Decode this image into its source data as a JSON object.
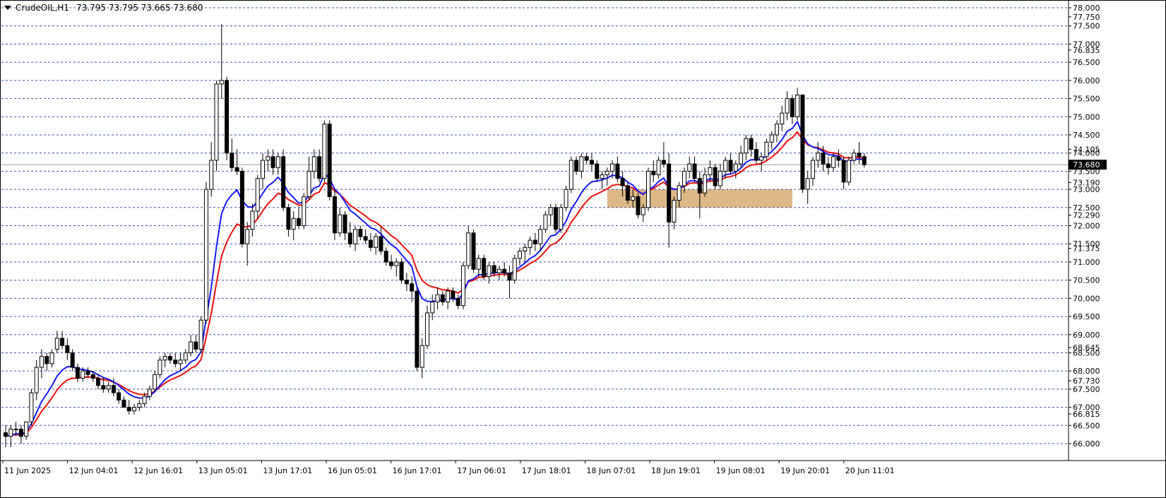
{
  "header": {
    "symbol_timeframe": "CrudeOIL,H1",
    "ohlc": "73.795 73.795 73.665 73.680"
  },
  "colors": {
    "background": "#ffffff",
    "grid": "#1c3a9a",
    "bull_fill": "#ffffff",
    "bear_fill": "#000000",
    "candle_outline": "#000000",
    "ma_fast": "#1a1aff",
    "ma_slow": "#ee1111",
    "zone": "#deb887",
    "current_price_badge": "#000000",
    "current_price_line": "#9a9a9a"
  },
  "chart_data": {
    "type": "candlestick",
    "symbol": "CrudeOIL",
    "timeframe": "H1",
    "y_range": [
      65.8,
      78.0
    ],
    "grid": true,
    "price_levels": [
      78.0,
      77.5,
      77.0,
      76.5,
      76.0,
      75.5,
      75.0,
      74.5,
      74.0,
      73.5,
      73.0,
      72.5,
      72.0,
      71.5,
      71.0,
      70.5,
      70.0,
      69.5,
      69.0,
      68.5,
      68.0,
      67.5,
      67.0,
      66.5,
      66.0
    ],
    "y_tick_labels": [
      "78.000",
      "77.750",
      "77.500",
      "77.000",
      "76.835",
      "76.500",
      "76.000",
      "75.500",
      "75.000",
      "74.500",
      "74.105",
      "74.000",
      "73.500",
      "73.190",
      "73.000",
      "72.500",
      "72.290",
      "72.000",
      "71.500",
      "71.375",
      "71.000",
      "70.500",
      "70.000",
      "69.500",
      "69.000",
      "68.645",
      "68.500",
      "68.000",
      "67.730",
      "67.500",
      "67.000",
      "66.815",
      "66.500",
      "66.000"
    ],
    "x_labels": [
      "11 Jun 2025",
      "12 Jun 04:01",
      "12 Jun 16:01",
      "13 Jun 05:01",
      "13 Jun 17:01",
      "16 Jun 05:01",
      "16 Jun 17:01",
      "17 Jun 06:01",
      "17 Jun 18:01",
      "18 Jun 07:01",
      "18 Jun 19:01",
      "19 Jun 08:01",
      "19 Jun 20:01",
      "20 Jun 11:01"
    ],
    "current_price": 73.68,
    "current_price_label": "73.680",
    "zone": {
      "price_top": 73.0,
      "price_bottom": 72.5,
      "start_bar": 117,
      "end_bar": 153
    },
    "candles": [
      [
        66.3,
        66.5,
        65.9,
        66.2
      ],
      [
        66.2,
        66.5,
        65.9,
        66.4
      ],
      [
        66.4,
        66.6,
        66.2,
        66.4
      ],
      [
        66.4,
        66.5,
        66.0,
        66.2
      ],
      [
        66.2,
        66.6,
        66.1,
        66.6
      ],
      [
        66.6,
        67.5,
        66.5,
        67.4
      ],
      [
        67.4,
        68.3,
        67.2,
        68.1
      ],
      [
        68.1,
        68.6,
        67.8,
        68.4
      ],
      [
        68.4,
        68.5,
        68.0,
        68.2
      ],
      [
        68.2,
        68.6,
        68.1,
        68.5
      ],
      [
        68.6,
        69.1,
        68.5,
        68.9
      ],
      [
        68.9,
        69.1,
        68.6,
        68.7
      ],
      [
        68.7,
        68.9,
        68.3,
        68.5
      ],
      [
        68.5,
        68.6,
        68.0,
        68.1
      ],
      [
        68.1,
        68.2,
        67.7,
        67.8
      ],
      [
        67.8,
        68.1,
        67.7,
        68.0
      ],
      [
        68.0,
        68.1,
        67.8,
        67.9
      ],
      [
        67.9,
        68.0,
        67.7,
        67.8
      ],
      [
        67.8,
        67.9,
        67.5,
        67.6
      ],
      [
        67.6,
        67.8,
        67.4,
        67.5
      ],
      [
        67.5,
        67.7,
        67.4,
        67.6
      ],
      [
        67.6,
        67.8,
        67.3,
        67.4
      ],
      [
        67.4,
        67.5,
        67.1,
        67.2
      ],
      [
        67.2,
        67.3,
        67.0,
        67.0
      ],
      [
        67.0,
        67.2,
        66.8,
        66.9
      ],
      [
        66.9,
        67.1,
        66.8,
        67.0
      ],
      [
        67.0,
        67.2,
        66.9,
        67.1
      ],
      [
        67.1,
        67.4,
        67.0,
        67.3
      ],
      [
        67.3,
        67.6,
        67.2,
        67.5
      ],
      [
        67.5,
        68.0,
        67.4,
        67.9
      ],
      [
        67.9,
        68.4,
        67.8,
        68.3
      ],
      [
        68.3,
        68.5,
        68.1,
        68.4
      ],
      [
        68.4,
        68.5,
        68.2,
        68.3
      ],
      [
        68.3,
        68.5,
        68.1,
        68.2
      ],
      [
        68.2,
        68.5,
        68.0,
        68.3
      ],
      [
        68.3,
        68.6,
        68.2,
        68.5
      ],
      [
        68.5,
        69.0,
        68.4,
        68.8
      ],
      [
        68.8,
        69.0,
        68.5,
        68.6
      ],
      [
        68.6,
        69.5,
        68.5,
        69.4
      ],
      [
        69.4,
        73.2,
        69.3,
        73.0
      ],
      [
        73.0,
        74.3,
        72.8,
        73.8
      ],
      [
        73.8,
        76.0,
        73.5,
        75.9
      ],
      [
        75.9,
        77.55,
        75.5,
        76.0
      ],
      [
        76.0,
        76.1,
        73.8,
        74.0
      ],
      [
        74.0,
        74.4,
        73.5,
        73.6
      ],
      [
        73.6,
        74.1,
        73.4,
        73.5
      ],
      [
        73.5,
        73.6,
        71.4,
        71.5
      ],
      [
        71.5,
        72.1,
        70.9,
        71.9
      ],
      [
        71.9,
        72.6,
        71.7,
        72.4
      ],
      [
        72.4,
        73.4,
        72.2,
        73.3
      ],
      [
        73.3,
        74.0,
        73.0,
        73.8
      ],
      [
        73.8,
        74.1,
        73.5,
        73.9
      ],
      [
        73.9,
        74.1,
        73.4,
        73.6
      ],
      [
        73.6,
        74.0,
        73.4,
        73.9
      ],
      [
        73.9,
        74.1,
        72.4,
        72.5
      ],
      [
        72.5,
        72.6,
        71.7,
        71.9
      ],
      [
        71.9,
        72.4,
        71.6,
        72.2
      ],
      [
        72.2,
        72.5,
        71.9,
        72.0
      ],
      [
        72.0,
        72.9,
        71.9,
        72.8
      ],
      [
        72.8,
        73.9,
        72.7,
        73.5
      ],
      [
        73.5,
        74.1,
        73.3,
        73.9
      ],
      [
        73.9,
        74.1,
        73.2,
        73.3
      ],
      [
        73.3,
        74.9,
        73.2,
        74.8
      ],
      [
        74.8,
        74.9,
        72.7,
        72.8
      ],
      [
        72.8,
        73.0,
        71.6,
        71.8
      ],
      [
        71.8,
        72.5,
        71.7,
        72.3
      ],
      [
        72.3,
        72.4,
        71.6,
        71.8
      ],
      [
        71.8,
        72.1,
        71.4,
        71.5
      ],
      [
        71.5,
        72.0,
        71.3,
        71.9
      ],
      [
        71.9,
        72.0,
        71.6,
        71.7
      ],
      [
        71.7,
        71.9,
        71.5,
        71.6
      ],
      [
        71.6,
        71.8,
        71.3,
        71.4
      ],
      [
        71.4,
        71.8,
        71.2,
        71.7
      ],
      [
        71.7,
        72.0,
        71.2,
        71.3
      ],
      [
        71.3,
        71.4,
        70.9,
        71.0
      ],
      [
        71.0,
        71.2,
        70.8,
        70.9
      ],
      [
        70.9,
        71.1,
        70.6,
        71.0
      ],
      [
        71.0,
        71.1,
        70.4,
        70.5
      ],
      [
        70.5,
        70.7,
        70.2,
        70.4
      ],
      [
        70.4,
        70.6,
        69.9,
        70.2
      ],
      [
        70.2,
        70.3,
        68.0,
        68.1
      ],
      [
        68.1,
        68.9,
        67.8,
        68.7
      ],
      [
        68.7,
        69.8,
        68.6,
        69.6
      ],
      [
        69.6,
        70.1,
        69.4,
        69.9
      ],
      [
        69.9,
        70.3,
        69.7,
        70.1
      ],
      [
        70.1,
        70.2,
        69.8,
        69.9
      ],
      [
        69.9,
        70.3,
        69.7,
        70.2
      ],
      [
        70.2,
        70.3,
        69.9,
        70.0
      ],
      [
        70.0,
        70.1,
        69.7,
        69.8
      ],
      [
        69.8,
        71.0,
        69.7,
        70.9
      ],
      [
        70.9,
        72.0,
        70.8,
        71.8
      ],
      [
        71.8,
        71.9,
        70.7,
        70.8
      ],
      [
        70.8,
        71.2,
        70.6,
        71.1
      ],
      [
        71.1,
        71.2,
        70.5,
        70.6
      ],
      [
        70.6,
        71.0,
        70.4,
        70.9
      ],
      [
        70.9,
        71.0,
        70.6,
        70.7
      ],
      [
        70.7,
        70.9,
        70.5,
        70.8
      ],
      [
        70.8,
        71.0,
        70.6,
        70.7
      ],
      [
        70.7,
        70.9,
        70.0,
        70.5
      ],
      [
        70.5,
        71.2,
        70.4,
        71.1
      ],
      [
        71.1,
        71.4,
        70.9,
        71.3
      ],
      [
        71.3,
        71.5,
        71.0,
        71.4
      ],
      [
        71.4,
        71.7,
        71.2,
        71.6
      ],
      [
        71.6,
        71.8,
        71.3,
        71.5
      ],
      [
        71.5,
        72.0,
        71.3,
        71.9
      ],
      [
        71.9,
        72.4,
        71.8,
        72.3
      ],
      [
        72.3,
        72.6,
        72.0,
        72.5
      ],
      [
        72.5,
        72.6,
        71.8,
        71.9
      ],
      [
        71.9,
        72.6,
        71.8,
        72.5
      ],
      [
        72.5,
        73.1,
        72.4,
        73.0
      ],
      [
        73.0,
        73.9,
        72.9,
        73.8
      ],
      [
        73.8,
        73.9,
        73.4,
        73.5
      ],
      [
        73.5,
        74.0,
        73.3,
        73.9
      ],
      [
        73.9,
        74.0,
        73.7,
        73.8
      ],
      [
        73.8,
        74.0,
        73.5,
        73.7
      ],
      [
        73.7,
        73.8,
        73.2,
        73.3
      ],
      [
        73.3,
        73.5,
        73.0,
        73.4
      ],
      [
        73.4,
        73.6,
        73.1,
        73.5
      ],
      [
        73.5,
        73.8,
        73.3,
        73.7
      ],
      [
        73.7,
        73.9,
        73.2,
        73.3
      ],
      [
        73.3,
        73.5,
        72.8,
        73.1
      ],
      [
        73.1,
        73.2,
        72.6,
        72.7
      ],
      [
        72.7,
        73.0,
        72.5,
        72.8
      ],
      [
        72.8,
        72.9,
        72.2,
        72.3
      ],
      [
        72.3,
        72.6,
        72.1,
        72.5
      ],
      [
        72.5,
        73.6,
        72.4,
        73.5
      ],
      [
        73.5,
        73.8,
        73.2,
        73.4
      ],
      [
        73.4,
        73.9,
        73.3,
        73.8
      ],
      [
        73.8,
        74.3,
        73.6,
        73.7
      ],
      [
        73.7,
        74.0,
        71.4,
        72.1
      ],
      [
        72.1,
        72.8,
        71.9,
        72.7
      ],
      [
        72.7,
        73.2,
        72.5,
        73.1
      ],
      [
        73.1,
        73.6,
        72.9,
        73.5
      ],
      [
        73.5,
        73.9,
        73.3,
        73.7
      ],
      [
        73.7,
        73.9,
        73.2,
        73.3
      ],
      [
        73.3,
        73.5,
        72.2,
        72.9
      ],
      [
        72.9,
        73.6,
        72.8,
        73.4
      ],
      [
        73.4,
        73.8,
        73.2,
        73.6
      ],
      [
        73.6,
        73.7,
        73.0,
        73.1
      ],
      [
        73.1,
        73.7,
        73.0,
        73.5
      ],
      [
        73.5,
        73.9,
        73.3,
        73.8
      ],
      [
        73.8,
        74.0,
        73.4,
        73.5
      ],
      [
        73.5,
        73.8,
        73.3,
        73.7
      ],
      [
        73.7,
        74.2,
        73.6,
        74.0
      ],
      [
        74.0,
        74.5,
        73.8,
        74.4
      ],
      [
        74.4,
        74.5,
        73.9,
        74.1
      ],
      [
        74.1,
        74.3,
        73.7,
        73.8
      ],
      [
        73.8,
        74.0,
        73.5,
        73.9
      ],
      [
        73.9,
        74.4,
        73.8,
        74.3
      ],
      [
        74.3,
        74.6,
        74.1,
        74.5
      ],
      [
        74.5,
        74.9,
        74.3,
        74.8
      ],
      [
        74.8,
        75.3,
        74.6,
        75.1
      ],
      [
        75.1,
        75.7,
        74.9,
        75.5
      ],
      [
        75.5,
        75.6,
        74.8,
        75.0
      ],
      [
        75.0,
        75.8,
        74.9,
        75.6
      ],
      [
        75.6,
        75.6,
        72.9,
        73.0
      ],
      [
        73.0,
        73.5,
        72.6,
        73.3
      ],
      [
        73.3,
        73.9,
        73.1,
        73.8
      ],
      [
        73.8,
        74.3,
        73.6,
        74.0
      ],
      [
        74.0,
        74.2,
        73.5,
        73.7
      ],
      [
        73.7,
        73.9,
        73.4,
        73.6
      ],
      [
        73.6,
        74.0,
        73.5,
        73.9
      ],
      [
        73.9,
        74.1,
        73.6,
        73.8
      ],
      [
        73.8,
        73.9,
        73.0,
        73.2
      ],
      [
        73.2,
        73.9,
        73.1,
        73.8
      ],
      [
        73.8,
        74.1,
        73.7,
        74.0
      ],
      [
        74.0,
        74.3,
        73.7,
        73.9
      ],
      [
        73.9,
        74.0,
        73.6,
        73.68
      ]
    ]
  }
}
